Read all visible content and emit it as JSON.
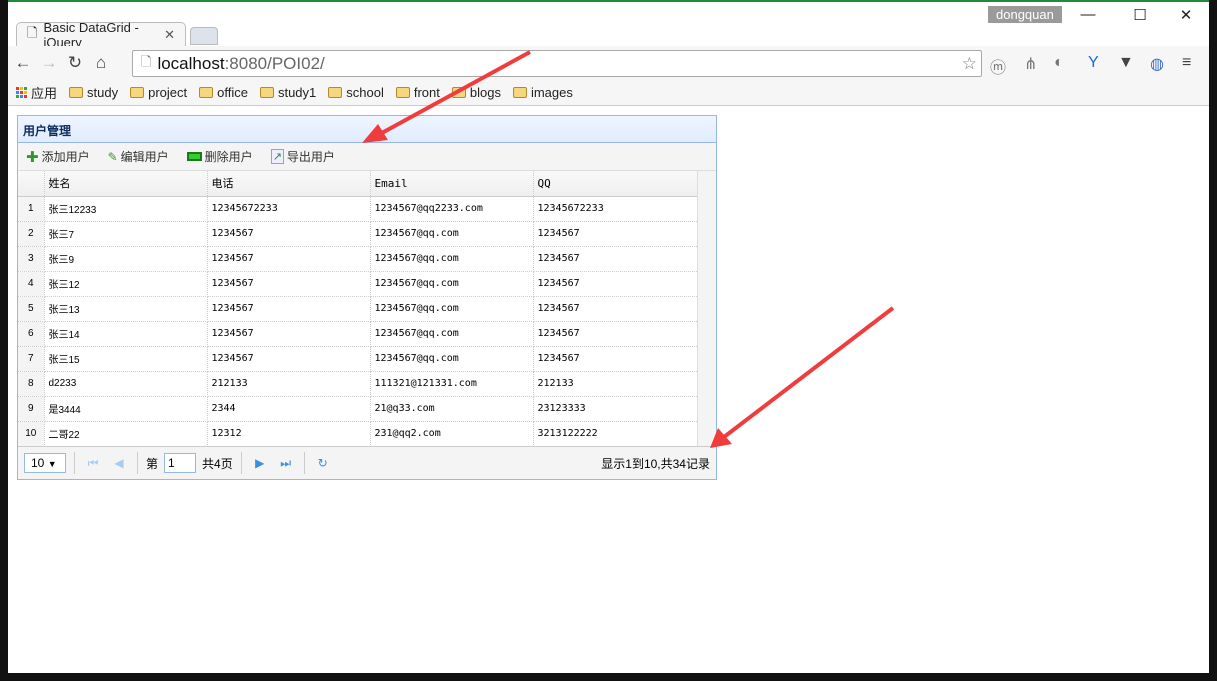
{
  "browser": {
    "user": "dongquan",
    "tab_title": "Basic DataGrid - jQuery",
    "url_host": "localhost",
    "url_rest": ":8080/POI02/",
    "bookmarks": [
      "应用",
      "study",
      "project",
      "office",
      "study1",
      "school",
      "front",
      "blogs",
      "images"
    ]
  },
  "panel": {
    "title": "用户管理",
    "toolbar": [
      {
        "label": "添加用户",
        "icon": "add-icon"
      },
      {
        "label": "编辑用户",
        "icon": "edit-icon"
      },
      {
        "label": "删除用户",
        "icon": "remove-icon"
      },
      {
        "label": "导出用户",
        "icon": "export-icon"
      }
    ],
    "columns": [
      "姓名",
      "电话",
      "Email",
      "QQ"
    ],
    "rows": [
      [
        "1",
        "张三12233",
        "12345672233",
        "1234567@qq2233.com",
        "12345672233"
      ],
      [
        "2",
        "张三7",
        "1234567",
        "1234567@qq.com",
        "1234567"
      ],
      [
        "3",
        "张三9",
        "1234567",
        "1234567@qq.com",
        "1234567"
      ],
      [
        "4",
        "张三12",
        "1234567",
        "1234567@qq.com",
        "1234567"
      ],
      [
        "5",
        "张三13",
        "1234567",
        "1234567@qq.com",
        "1234567"
      ],
      [
        "6",
        "张三14",
        "1234567",
        "1234567@qq.com",
        "1234567"
      ],
      [
        "7",
        "张三15",
        "1234567",
        "1234567@qq.com",
        "1234567"
      ],
      [
        "8",
        "d2233",
        "212133",
        "111321@121331.com",
        "212133"
      ],
      [
        "9",
        "是3444",
        "2344",
        "21@q33.com",
        "23123333"
      ],
      [
        "10",
        "二哥22",
        "12312",
        "231@qq2.com",
        "3213122222"
      ]
    ],
    "pager": {
      "page_size": "10",
      "page_prefix": "第",
      "page": "1",
      "page_total": "共4页",
      "info": "显示1到10,共34记录"
    }
  },
  "colors": {
    "accent": "#95b8e7",
    "annotation_arrow": "#f03c3c"
  }
}
